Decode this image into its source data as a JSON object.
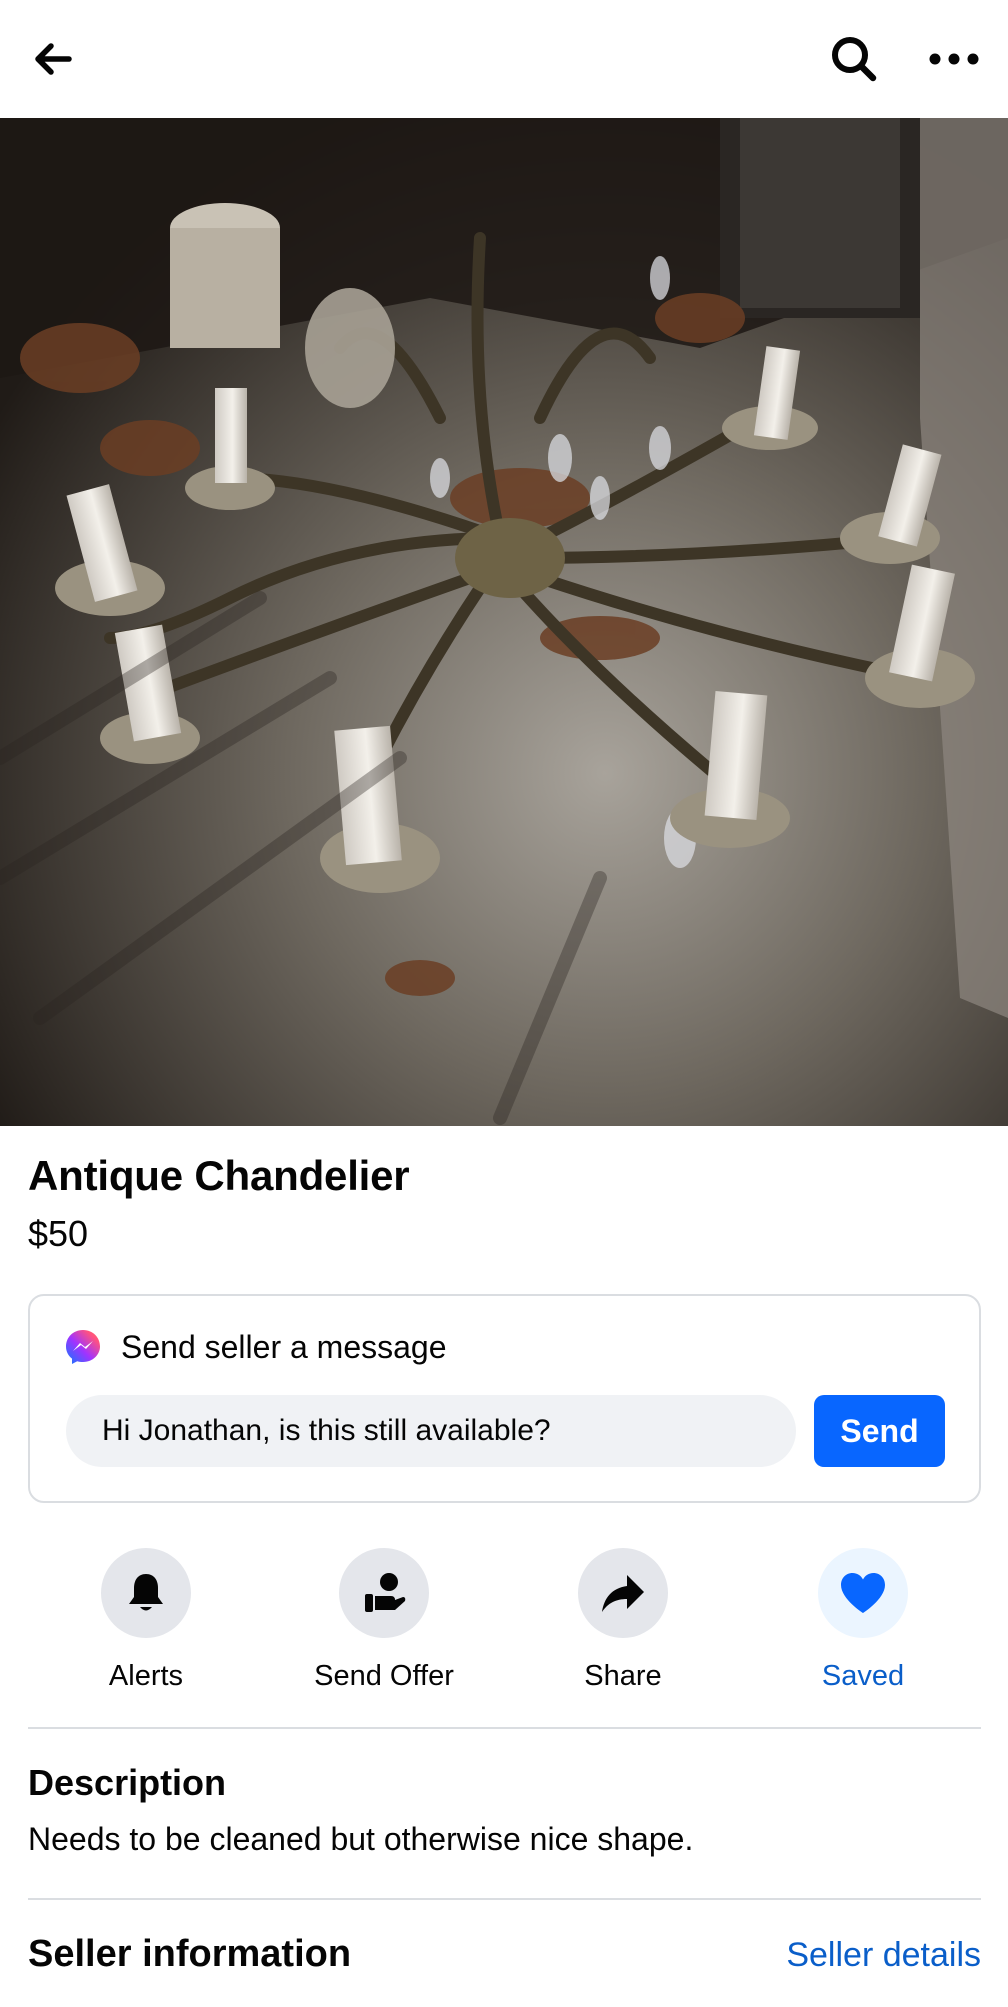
{
  "topbar": {
    "back_icon": "arrow-left-icon",
    "search_icon": "search-icon",
    "more_icon": "more-horizontal-icon"
  },
  "listing": {
    "photo_alt": "Antique Chandelier",
    "title": "Antique Chandelier",
    "price": "$50"
  },
  "message": {
    "header": "Send seller a message",
    "icon": "messenger-icon",
    "input_value": "Hi Jonathan, is this still available?",
    "send_label": "Send"
  },
  "actions": [
    {
      "label": "Alerts",
      "icon": "bell-icon"
    },
    {
      "label": "Send Offer",
      "icon": "offer-icon"
    },
    {
      "label": "Share",
      "icon": "share-icon"
    },
    {
      "label": "Saved",
      "icon": "heart-icon"
    }
  ],
  "description": {
    "heading": "Description",
    "text": "Needs to be cleaned but otherwise nice shape."
  },
  "seller": {
    "heading": "Seller information",
    "details_link": "Seller details"
  },
  "colors": {
    "accent": "#0866ff",
    "link": "#0a5ec9",
    "saved_bg": "#ebf5ff",
    "action_bg": "#e4e6eb",
    "input_bg": "#f0f2f5"
  }
}
